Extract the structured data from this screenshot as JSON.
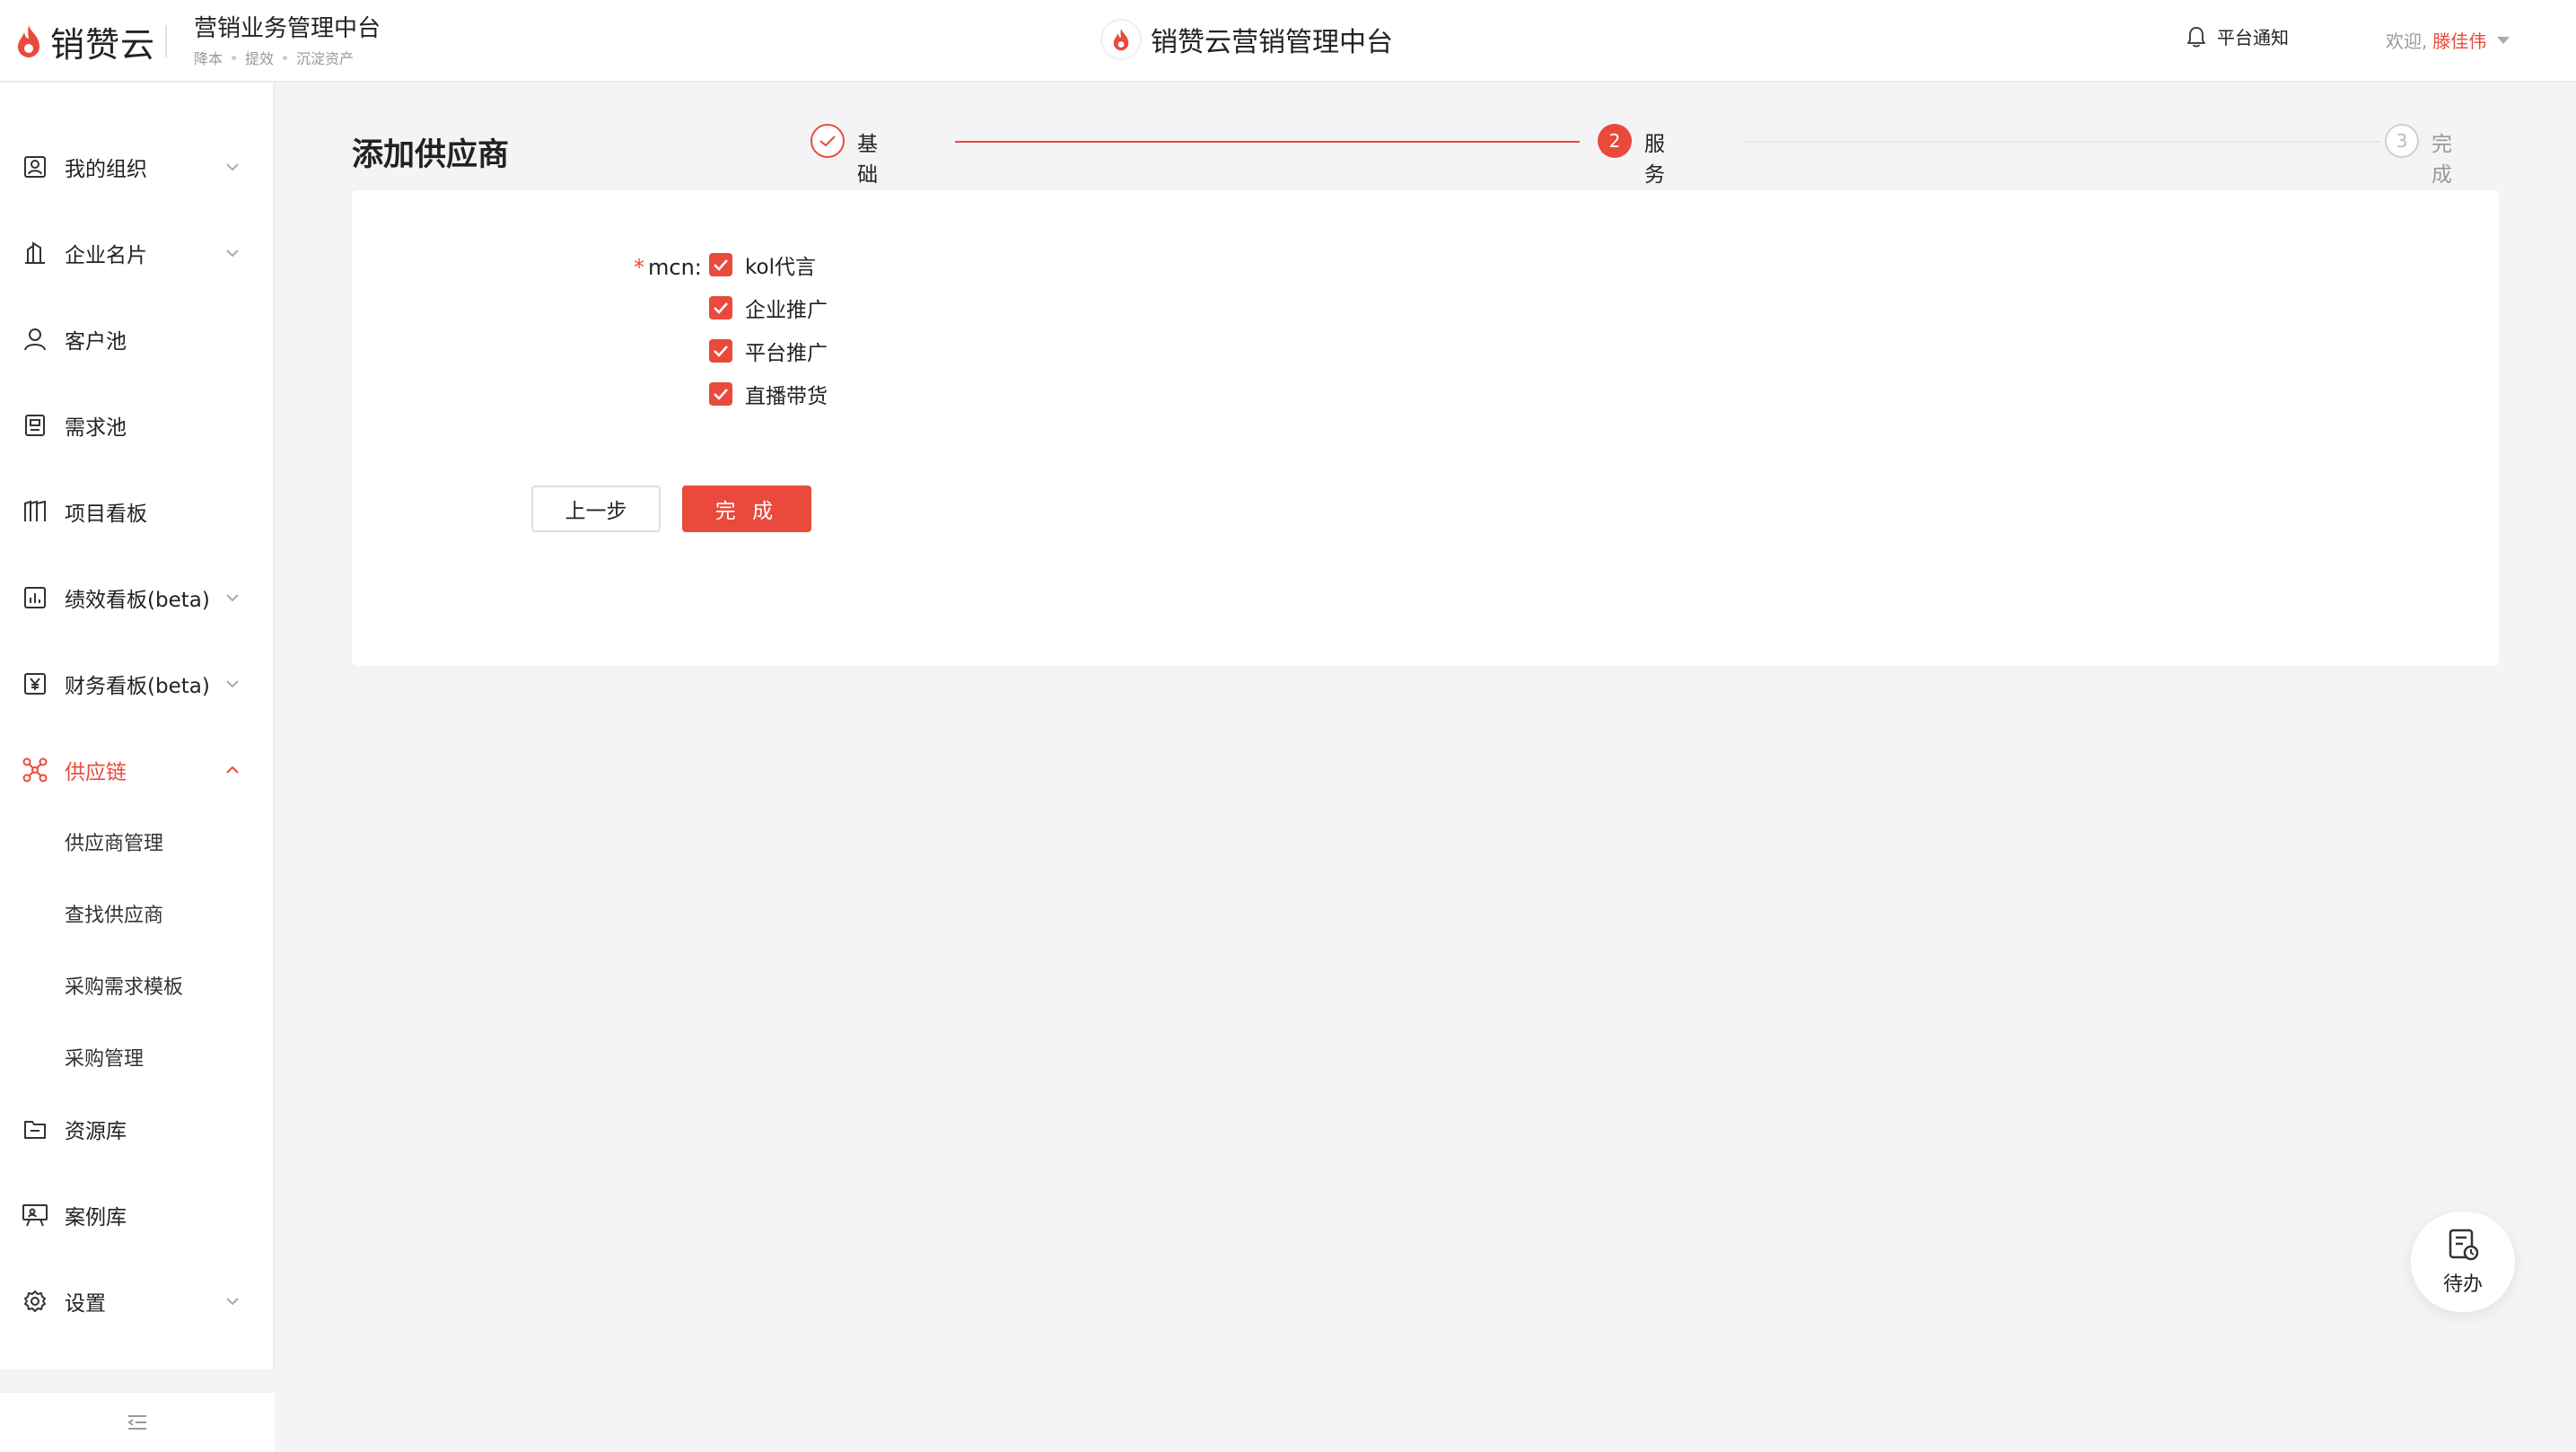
{
  "header": {
    "logo_text": "销赞云",
    "product_title": "营销业务管理中台",
    "product_tags": [
      "降本",
      "提效",
      "沉淀资产"
    ],
    "center_title": "销赞云营销管理中台",
    "notify_label": "平台通知",
    "welcome_label": "欢迎,",
    "user_name": "滕佳伟"
  },
  "sidebar": {
    "items": [
      {
        "label": "我的组织",
        "icon": "org-icon",
        "expandable": true
      },
      {
        "label": "企业名片",
        "icon": "building-icon",
        "expandable": true
      },
      {
        "label": "客户池",
        "icon": "user-icon",
        "expandable": false
      },
      {
        "label": "需求池",
        "icon": "document-icon",
        "expandable": false
      },
      {
        "label": "项目看板",
        "icon": "board-icon",
        "expandable": false
      },
      {
        "label": "绩效看板(beta)",
        "icon": "bar-chart-icon",
        "expandable": true
      },
      {
        "label": "财务看板(beta)",
        "icon": "yen-icon",
        "expandable": true
      },
      {
        "label": "供应链",
        "icon": "network-icon",
        "expandable": true,
        "active": true
      },
      {
        "label": "资源库",
        "icon": "folder-icon",
        "expandable": false
      },
      {
        "label": "案例库",
        "icon": "presentation-icon",
        "expandable": false
      },
      {
        "label": "设置",
        "icon": "gear-icon",
        "expandable": true
      }
    ],
    "supply_chain_children": [
      "供应商管理",
      "查找供应商",
      "采购需求模板",
      "采购管理"
    ]
  },
  "page": {
    "title": "添加供应商"
  },
  "steps": [
    {
      "number": "1",
      "label": "基础信息",
      "status": "done"
    },
    {
      "number": "2",
      "label": "服务项目",
      "status": "current"
    },
    {
      "number": "3",
      "label": "完成",
      "status": "pending"
    }
  ],
  "form": {
    "field_label": "mcn",
    "field_colon": ":",
    "required_mark": "*",
    "options": [
      {
        "label": "kol代言",
        "checked": true
      },
      {
        "label": "企业推广",
        "checked": true
      },
      {
        "label": "平台推广",
        "checked": true
      },
      {
        "label": "直播带货",
        "checked": true
      }
    ],
    "prev_button": "上一步",
    "done_button": "完 成"
  },
  "floating": {
    "todo_label": "待办"
  },
  "colors": {
    "accent": "#e94a3c",
    "background": "#f4f4f6"
  }
}
